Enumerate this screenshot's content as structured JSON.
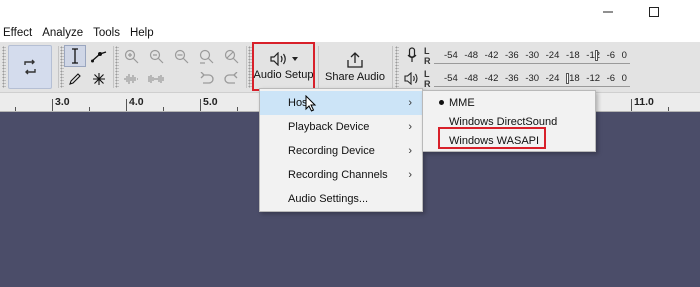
{
  "menubar": {
    "items": [
      "Effect",
      "Analyze",
      "Tools",
      "Help"
    ]
  },
  "toolbar": {
    "audio_setup_label": "Audio Setup",
    "share_audio_label": "Share Audio",
    "meter_scale": [
      "-54",
      "-48",
      "-42",
      "-36",
      "-30",
      "-24",
      "-18",
      "-12",
      "-6",
      "0"
    ],
    "meter_record_channel_labels": [
      "L",
      "R"
    ]
  },
  "ruler": {
    "labels": [
      "3.0",
      "4.0",
      "5.0",
      "11.0"
    ]
  },
  "audio_setup_menu": {
    "items": [
      {
        "label": "Host",
        "has_submenu": true
      },
      {
        "label": "Playback Device",
        "has_submenu": true
      },
      {
        "label": "Recording Device",
        "has_submenu": true
      },
      {
        "label": "Recording Channels",
        "has_submenu": true
      },
      {
        "label": "Audio Settings...",
        "has_submenu": false
      }
    ]
  },
  "host_submenu": {
    "items": [
      {
        "label": "MME",
        "selected": true
      },
      {
        "label": "Windows DirectSound",
        "selected": false
      },
      {
        "label": "Windows WASAPI",
        "selected": false
      }
    ]
  },
  "colors": {
    "highlight_red": "#d8202a",
    "track_background": "#4b4d69",
    "menu_hover": "#cce4f7"
  },
  "icons": [
    "minimize-icon",
    "maximize-icon",
    "loop-icon",
    "selection-tool-icon",
    "envelope-tool-icon",
    "draw-tool-icon",
    "multi-tool-icon",
    "zoom-in-icon",
    "zoom-out-icon",
    "fit-selection-icon",
    "fit-project-icon",
    "zoom-toggle-icon",
    "trim-icon",
    "silence-icon",
    "undo-icon",
    "redo-icon",
    "speaker-icon",
    "share-icon",
    "microphone-icon",
    "mouse-cursor-icon"
  ]
}
